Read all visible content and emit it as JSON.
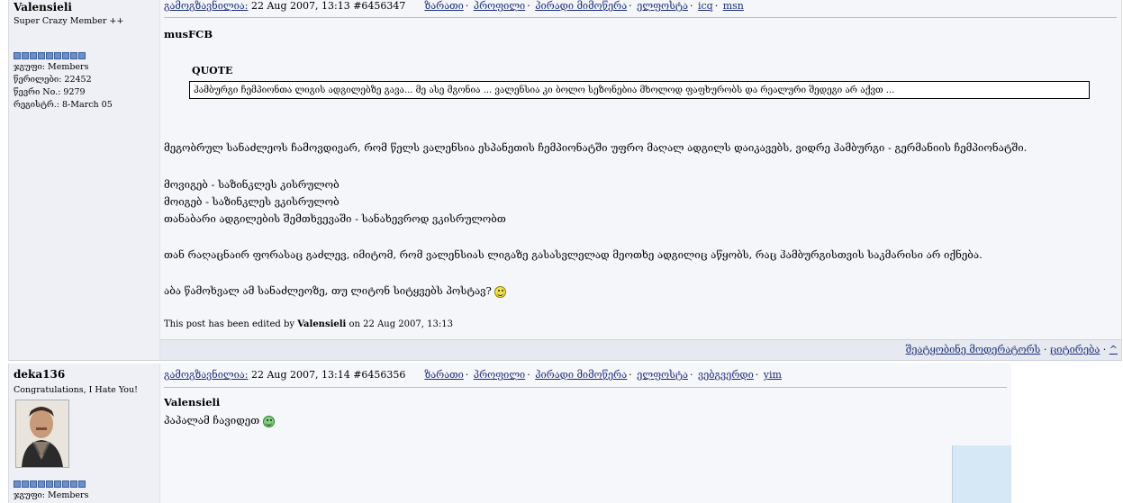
{
  "post1": {
    "author": "Valensieli",
    "member_title": "Super Crazy Member ++",
    "stats": [
      "ჯგუფი: Members",
      "წერილები: 22452",
      "წევრი No.: 9279",
      "რეგისტრ.: 8-March 05"
    ],
    "posted_label": "გამოგზავნილია:",
    "posted_meta": " 22 Aug 2007, 13:13  #6456347",
    "links": [
      "ზარათი",
      "პროფილი",
      "პირადი მიმოწერა",
      "ელფოსტა",
      "icq",
      "msn"
    ],
    "quoted_user": "musFCB",
    "quote_label": "QUOTE",
    "quote_text": "ჰამბურგი ჩემპიონთა ლიგის ადგილებზე გავა... მე ასე მგონია ... ვალენსია კი ბოლო სეზონებია მხოლოდ ფაფხურობს და რეალური შედეგი არ აქვთ ...",
    "body": [
      "მეგობრულ სანაძლეოს ჩამოვდივარ, რომ წელს ვალენსია ესპანეთის ჩემპიონატში უფრო მაღალ ადგილს დაიკავებს, ვიდრე ჰამბურგი - გერმანიის ჩემპიონატში.",
      "მოვიგებ - საზინკლეს კისრულობ",
      "მოიგებ - საზინკლეს ვკისრულობ",
      "თანაბარი ადგილების შემთხვევაში - სანახევროდ ვკისრულობთ",
      "თან რაღაცნაირ ფორასაც გაძლევ, იმიტომ, რომ ვალენსიას ლიგაზე გასასვლელად მეოთხე ადგილიც აწყობს, რაც ჰამბურგისთვის საკმარისი არ იქნება.",
      "აბა წამოხვალ ამ სანაძლეოზე, თუ ლიტონ სიტყვებს პოსტავ?"
    ],
    "edited_prefix": "This post has been edited by ",
    "edited_by": "Valensieli",
    "edited_suffix": " on 22 Aug 2007, 13:13",
    "footer_report": "შეატყობინე მოდერატორს",
    "footer_quote": "ციტირება",
    "footer_up": "^"
  },
  "post2": {
    "author": "deka136",
    "member_title": "Congratulations, I Hate You!",
    "stats": [
      "ჯგუფი: Members"
    ],
    "posted_label": "გამოგზავნილია:",
    "posted_meta": " 22 Aug 2007, 13:14  #6456356",
    "links": [
      "ზარათი",
      "პროფილი",
      "პირადი მიმოწერა",
      "ელფოსტა",
      "ვებგვერდი",
      "yim"
    ],
    "quoted_user": "Valensieli",
    "body": [
      "პაპალამ ჩავიდეთ"
    ]
  },
  "colors": {
    "link": "#1a2e7a",
    "panel": "#eef0f5",
    "pip": "#6b8fc9"
  }
}
